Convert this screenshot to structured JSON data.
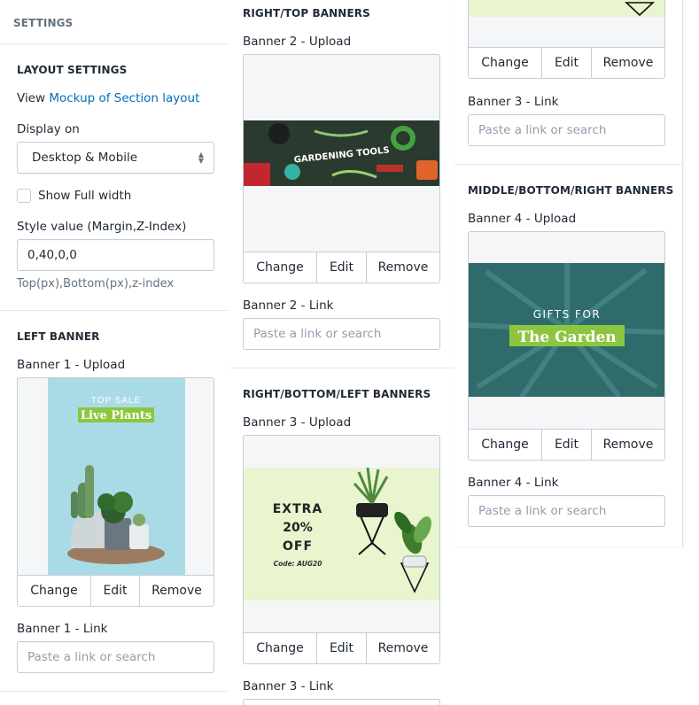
{
  "settings_header": "SETTINGS",
  "layout": {
    "heading": "LAYOUT SETTINGS",
    "view_prefix": "View",
    "view_link": "Mockup of Section layout",
    "display_label": "Display on",
    "display_value": "Desktop & Mobile",
    "show_full_width": "Show Full width",
    "style_label": "Style value (Margin,Z-Index)",
    "style_value": "0,40,0,0",
    "style_help": "Top(px),Bottom(px),z-index"
  },
  "buttons": {
    "change": "Change",
    "edit": "Edit",
    "remove": "Remove"
  },
  "link_placeholder": "Paste a link or search",
  "left_banner": {
    "heading": "LEFT BANNER",
    "upload_label": "Banner 1 - Upload",
    "image": {
      "top_text": "TOP SALE",
      "title": "Live Plants"
    },
    "link_label": "Banner 1 - Link"
  },
  "right_top": {
    "heading": "RIGHT/TOP BANNERS",
    "upload_label": "Banner 2 - Upload",
    "image": {
      "text": "GARDENING TOOLS"
    },
    "link_label": "Banner 2 - Link"
  },
  "right_bottom_left": {
    "heading": "RIGHT/BOTTOM/LEFT BANNERS",
    "upload_label": "Banner 3 - Upload",
    "image": {
      "line1": "EXTRA",
      "line2": "20%",
      "line3": "OFF",
      "code": "Code: AUG20"
    },
    "link_label": "Banner 3 - Link"
  },
  "col3_top": {
    "link_label": "Banner 3 - Link"
  },
  "middle_bottom_right": {
    "heading": "MIDDLE/BOTTOM/RIGHT BANNERS",
    "upload_label": "Banner 4 - Upload",
    "image": {
      "line1": "GIFTS FOR",
      "line2": "The Garden"
    },
    "link_label": "Banner 4 - Link"
  },
  "colors": {
    "link": "#006fbb",
    "accent_green": "#8cc63f",
    "banner_blue": "#a9dbe6",
    "banner_lime": "#e8f5cf",
    "banner_teal": "#2f6b6b"
  }
}
